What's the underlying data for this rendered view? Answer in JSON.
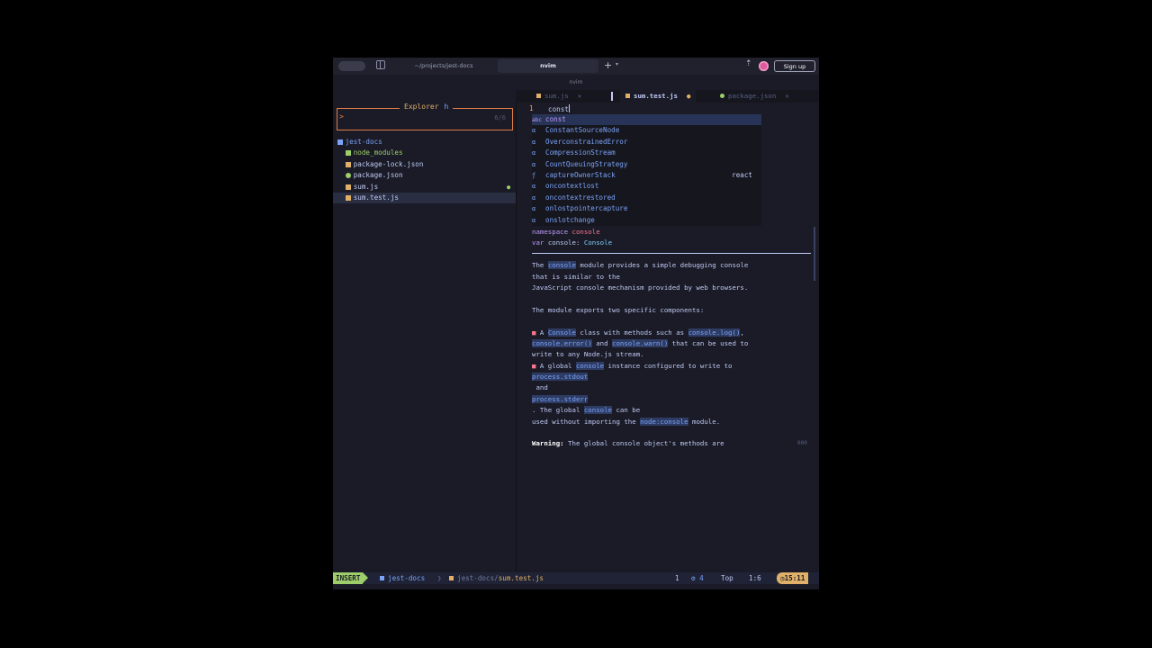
{
  "titlebar": {
    "path_tab": "~/projects/jest-docs",
    "active_tab": "nvim",
    "new_tab": "+",
    "dropdown": "▾",
    "share": "⇡",
    "signup": "Sign up"
  },
  "subtitle": "nvim",
  "explorer": {
    "title": "Explorer",
    "key": "h",
    "prompt": ">",
    "count": "6/6",
    "tree": [
      {
        "label": "jest-docs",
        "indent": "",
        "icon": "folder",
        "color": "#7aa2f7"
      },
      {
        "label": "node_modules",
        "indent": "  ",
        "icon": "folder",
        "color": "#9ece6a"
      },
      {
        "label": "package-lock.json",
        "indent": "  ",
        "icon": "json",
        "color": "#c0caf5"
      },
      {
        "label": "package.json",
        "indent": "  ",
        "icon": "npm",
        "color": "#c0caf5"
      },
      {
        "label": "sum.js",
        "indent": "  ",
        "icon": "js",
        "color": "#c0caf5"
      },
      {
        "label": "sum.test.js",
        "indent": "  ",
        "icon": "js",
        "color": "#c0caf5"
      }
    ],
    "git_mark": "●"
  },
  "buffers": [
    {
      "name": "sum.js",
      "close": "✕"
    },
    {
      "name": "sum.test.js",
      "modified": "●"
    },
    {
      "name": "package.json",
      "close": "✕"
    }
  ],
  "editor": {
    "line_number": "1",
    "text": "const"
  },
  "completion": [
    {
      "kind": "kw",
      "kind_glyph": "abc",
      "label": "const",
      "source": ""
    },
    {
      "kind": "var",
      "kind_glyph": "α",
      "label": "ConstantSourceNode",
      "source": ""
    },
    {
      "kind": "var",
      "kind_glyph": "α",
      "label": "OverconstrainedError",
      "source": ""
    },
    {
      "kind": "var",
      "kind_glyph": "α",
      "label": "CompressionStream",
      "source": ""
    },
    {
      "kind": "var",
      "kind_glyph": "α",
      "label": "CountQueuingStrategy",
      "source": ""
    },
    {
      "kind": "fn",
      "kind_glyph": "ƒ",
      "label": "captureOwnerStack",
      "source": "react"
    },
    {
      "kind": "var",
      "kind_glyph": "α",
      "label": "oncontextlost",
      "source": ""
    },
    {
      "kind": "var",
      "kind_glyph": "α",
      "label": "oncontextrestored",
      "source": ""
    },
    {
      "kind": "var",
      "kind_glyph": "α",
      "label": "onlostpointercapture",
      "source": ""
    },
    {
      "kind": "var",
      "kind_glyph": "α",
      "label": "onslotchange",
      "source": ""
    }
  ],
  "doc": {
    "sig1_kw": "namespace",
    "sig1_name": "console",
    "sig2_kw": "var",
    "sig2_name": "console:",
    "sig2_type": "Console",
    "p1_a": "The ",
    "p1_hl": "console",
    "p1_b": " module provides a simple debugging console",
    "p1_l2": "that is similar to the",
    "p1_l3": "JavaScript console mechanism provided by web browsers.",
    "p2": "The module exports two specific components:",
    "b1_a": " A ",
    "b1_hl1": "Console",
    "b1_b": " class with methods such as ",
    "b1_hl2": "console.log()",
    "b1_c": ",",
    "b1_l2_hl1": "console.error()",
    "b1_l2_b": " and ",
    "b1_l2_hl2": "console.warn()",
    "b1_l2_c": " that can be used to",
    "b1_l3": "write to any Node.js stream.",
    "b2_a": " A global ",
    "b2_hl": "console",
    "b2_b": " instance configured to write to",
    "b2_l2_hl": "process.stdout",
    "b2_l3": " and",
    "b2_l4_hl": "process.stderr",
    "b2_l5_a": ". The global ",
    "b2_l5_hl": "console",
    "b2_l5_b": " can be",
    "b2_l6_a": "used without importing the ",
    "b2_l6_hl": "node:console",
    "b2_l6_b": " module.",
    "warn_label": "Warning:",
    "warn_text": " The global console object's methods are",
    "more": "000"
  },
  "status": {
    "mode": "INSERT",
    "dir": "jest-docs",
    "sep": "❯",
    "file_prefix": "jest-docs/",
    "file_name": "sum.test.js",
    "diag_count": "1",
    "lsp": "⚙ 4",
    "position": "Top",
    "cursor": "1:6",
    "clock": "◷15:11"
  },
  "colors": {
    "accent_orange": "#e07d45",
    "insert_green": "#9ece6a",
    "clock_yellow": "#e0af68"
  }
}
